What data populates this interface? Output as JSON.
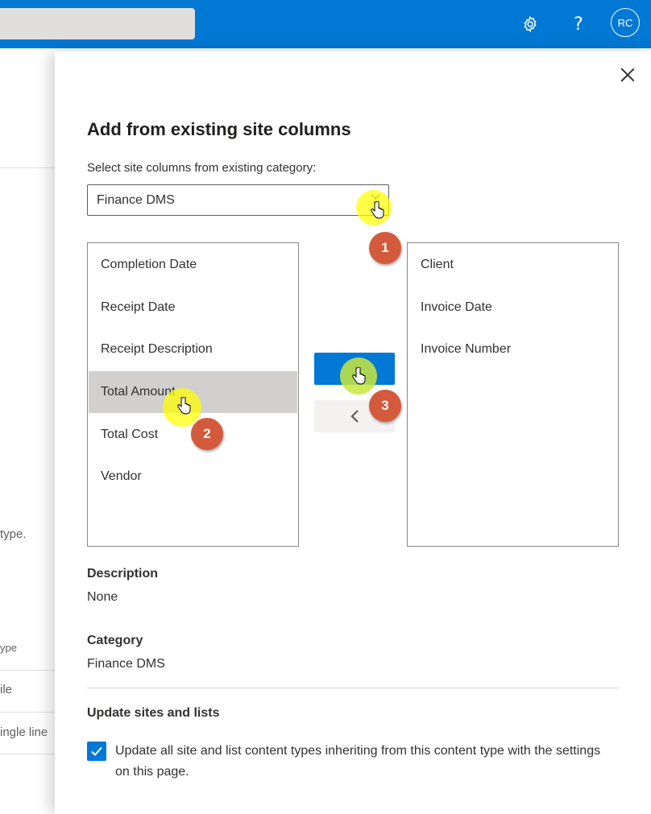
{
  "header": {
    "settings_icon": "gear-icon",
    "help_label": "?",
    "avatar_initials": "RC",
    "accent_color": "#0078d4"
  },
  "background_page": {
    "text_1": "type.",
    "text_2": "ype",
    "text_3": "ile",
    "text_4": "ingle line"
  },
  "panel": {
    "title": "Add from existing site columns",
    "category_label": "Select site columns from existing category:",
    "category_selected": "Finance DMS",
    "available_columns": [
      {
        "label": "Completion Date"
      },
      {
        "label": "Receipt Date"
      },
      {
        "label": "Receipt Description"
      },
      {
        "label": "Total Amount",
        "selected": true
      },
      {
        "label": "Total Cost"
      },
      {
        "label": "Vendor"
      }
    ],
    "added_columns": [
      {
        "label": "Client"
      },
      {
        "label": "Invoice Date"
      },
      {
        "label": "Invoice Number"
      }
    ],
    "description_title": "Description",
    "description_value": "None",
    "category_title": "Category",
    "category_value": "Finance DMS",
    "update_title": "Update sites and lists",
    "update_checkbox_label": "Update all site and list content types inheriting from this content type with the settings on this page.",
    "update_checked": true
  },
  "annotations": {
    "step_1": "1",
    "step_2": "2",
    "step_3": "3",
    "step_color": "#d35a3c",
    "highlight_color": "#ffff00"
  }
}
